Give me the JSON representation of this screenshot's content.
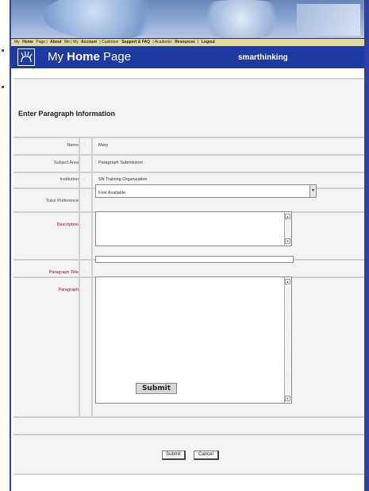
{
  "nav": {
    "items": [
      {
        "label": "My ",
        "bold": false
      },
      {
        "label": "Home",
        "bold": true
      },
      {
        "label": " Page | ",
        "bold": false
      },
      {
        "label": "About",
        "bold": true
      },
      {
        "label": " Me | My ",
        "bold": false
      },
      {
        "label": "Account",
        "bold": true
      },
      {
        "label": " | Customer ",
        "bold": false
      },
      {
        "label": "Support & FAQ",
        "bold": true
      },
      {
        "label": " | Academic ",
        "bold": false
      },
      {
        "label": "Resources",
        "bold": true
      },
      {
        "label": " | ",
        "bold": false
      },
      {
        "label": "Logout",
        "bold": true
      }
    ]
  },
  "header": {
    "title_prefix": "My ",
    "title_bold": "Home",
    "title_suffix": " Page",
    "company": "smarthinking"
  },
  "form": {
    "title": "Enter Paragraph Information",
    "name_label": "Name",
    "name_value": "Mary",
    "subject_label": "Subject Area",
    "subject_value": "Paragraph Submission",
    "institution_label": "Institution",
    "institution_value": "SN Training Organization",
    "tutor_label": "Tutor Preference",
    "tutor_value": "First Available",
    "description_label": "Description",
    "paragraph_title_label": "Paragraph Title",
    "paragraph_label": "Paragraph",
    "colon": ":",
    "embedded_button": "Submit"
  },
  "buttons": {
    "submit": "Submit",
    "cancel": "Cancel"
  },
  "icons": {
    "logo": "hand-logo-icon",
    "dropdown": "chevron-down-icon",
    "scroll_up": "scroll-up-icon",
    "scroll_down": "scroll-down-icon"
  },
  "colors": {
    "brand_blue": "#1c3aa0",
    "required_label": "#c00000",
    "nav_background": "#e4d9a0"
  }
}
